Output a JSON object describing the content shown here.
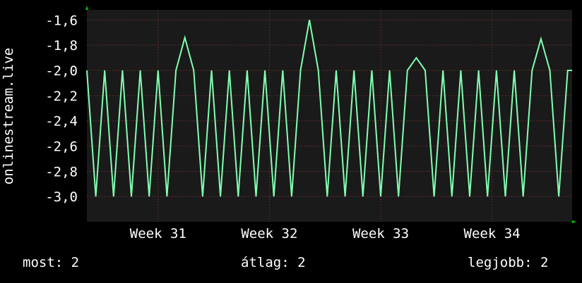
{
  "chart_data": {
    "type": "line",
    "ylabel": "onlinestream.live",
    "yticks": [
      "-1,6",
      "-1,8",
      "-2,0",
      "-2,2",
      "-2,4",
      "-2,6",
      "-2,8",
      "-3,0"
    ],
    "ytick_values": [
      -1.6,
      -1.8,
      -2.0,
      -2.2,
      -2.4,
      -2.6,
      -2.8,
      -3.0
    ],
    "ylim": [
      -3.2,
      -1.52
    ],
    "xticks": [
      "Week 31",
      "Week 32",
      "Week 33",
      "Week 34"
    ],
    "xtick_weeks": [
      31,
      32,
      33,
      34
    ],
    "xlim_weeks": [
      30.36,
      34.72
    ],
    "grid": true,
    "series": [
      {
        "color": "#80ffb0",
        "x_weeks": [
          30.36,
          30.44,
          30.52,
          30.6,
          30.68,
          30.76,
          30.84,
          30.92,
          31.0,
          31.08,
          31.16,
          31.24,
          31.32,
          31.4,
          31.48,
          31.56,
          31.64,
          31.72,
          31.8,
          31.88,
          31.96,
          32.04,
          32.12,
          32.2,
          32.28,
          32.36,
          32.44,
          32.52,
          32.6,
          32.68,
          32.76,
          32.84,
          32.92,
          33.0,
          33.08,
          33.16,
          33.24,
          33.32,
          33.4,
          33.48,
          33.56,
          33.64,
          33.72,
          33.8,
          33.88,
          33.96,
          34.04,
          34.12,
          34.2,
          34.28,
          34.36,
          34.44,
          34.52,
          34.6,
          34.68,
          34.72
        ],
        "values": [
          -2.0,
          -3.0,
          -2.0,
          -3.0,
          -2.0,
          -3.0,
          -2.0,
          -3.0,
          -2.0,
          -3.0,
          -2.0,
          -1.74,
          -2.0,
          -3.0,
          -2.0,
          -3.0,
          -2.0,
          -3.0,
          -2.0,
          -3.0,
          -2.0,
          -3.0,
          -2.0,
          -3.0,
          -2.0,
          -1.6,
          -2.0,
          -3.0,
          -2.0,
          -3.0,
          -2.0,
          -3.0,
          -2.0,
          -3.0,
          -2.0,
          -3.0,
          -2.0,
          -1.9,
          -2.0,
          -3.0,
          -2.0,
          -3.0,
          -2.0,
          -3.0,
          -2.0,
          -3.0,
          -2.0,
          -3.0,
          -2.0,
          -3.0,
          -2.0,
          -1.75,
          -2.0,
          -3.0,
          -2.0,
          -2.0
        ]
      }
    ]
  },
  "legend": {
    "current": "most: 2",
    "average": "átlag: 2",
    "best": "legjobb: 2"
  },
  "colors": {
    "background": "#000000",
    "plot_bg": "#1a1a1a",
    "grid": "#5a2a2a",
    "line": "#80ffb0",
    "arrow": "#00c800"
  }
}
